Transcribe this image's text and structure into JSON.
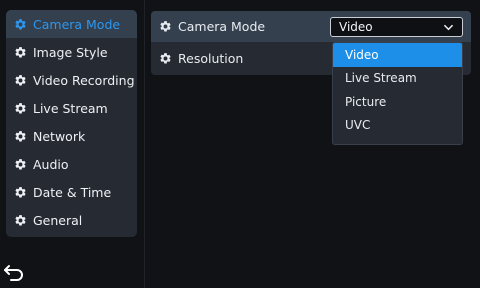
{
  "sidebar": {
    "items": [
      {
        "label": "Camera Mode",
        "icon": "gear-icon"
      },
      {
        "label": "Image Style",
        "icon": "gear-icon"
      },
      {
        "label": "Video Recording",
        "icon": "gear-icon"
      },
      {
        "label": "Live Stream",
        "icon": "gear-icon"
      },
      {
        "label": "Network",
        "icon": "gear-icon"
      },
      {
        "label": "Audio",
        "icon": "gear-icon"
      },
      {
        "label": "Date & Time",
        "icon": "gear-icon"
      },
      {
        "label": "General",
        "icon": "gear-icon"
      }
    ],
    "active_index": 0
  },
  "settings": {
    "rows": [
      {
        "label": "Camera Mode",
        "icon": "gear-icon"
      },
      {
        "label": "Resolution",
        "icon": "gear-icon"
      }
    ],
    "camera_mode_value": "Video",
    "dropdown_options": [
      "Video",
      "Live Stream",
      "Picture",
      "UVC"
    ],
    "highlighted_option": "Video"
  },
  "nav": {
    "back_icon": "back-arrow-icon"
  },
  "colors": {
    "background": "#101216",
    "panel": "#262a32",
    "selected_row": "#35404e",
    "accent": "#2b97f0",
    "highlight": "#1e8fe8"
  }
}
